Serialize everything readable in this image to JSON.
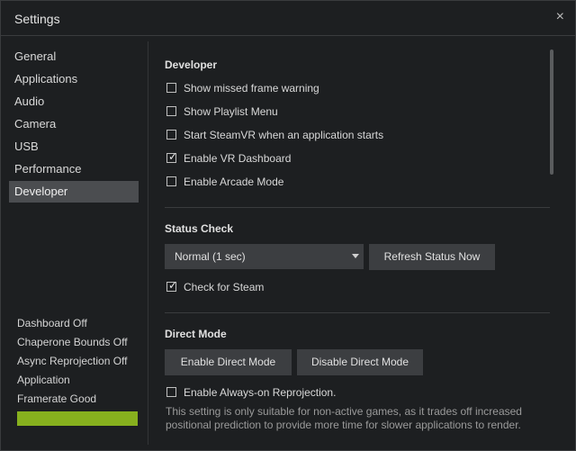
{
  "window": {
    "title": "Settings",
    "close_glyph": "×"
  },
  "sidebar": {
    "items": [
      {
        "label": "General"
      },
      {
        "label": "Applications"
      },
      {
        "label": "Audio"
      },
      {
        "label": "Camera"
      },
      {
        "label": "USB"
      },
      {
        "label": "Performance"
      },
      {
        "label": "Developer",
        "active": true
      }
    ],
    "status": {
      "dashboard": "Dashboard Off",
      "chaperone": "Chaperone Bounds Off",
      "async": "Async Reprojection Off",
      "application": "Application",
      "framerate": "Framerate Good",
      "framerate_color": "#87b01e"
    }
  },
  "developer": {
    "title": "Developer",
    "options": [
      {
        "label": "Show missed frame warning",
        "checked": false
      },
      {
        "label": "Show Playlist Menu",
        "checked": false
      },
      {
        "label": "Start SteamVR when an application starts",
        "checked": false
      },
      {
        "label": "Enable VR Dashboard",
        "checked": true
      },
      {
        "label": "Enable Arcade Mode",
        "checked": false
      }
    ]
  },
  "status_check": {
    "title": "Status Check",
    "select_value": "Normal (1 sec)",
    "refresh_label": "Refresh Status Now",
    "check_steam_label": "Check for Steam",
    "check_steam_checked": true
  },
  "direct_mode": {
    "title": "Direct Mode",
    "enable_label": "Enable Direct Mode",
    "disable_label": "Disable Direct Mode",
    "reprojection_label": "Enable Always-on Reprojection.",
    "reprojection_checked": false,
    "note": "This setting is only suitable for non-active games, as it trades off increased positional prediction to provide more time for slower applications to render."
  },
  "icons": {
    "close": "close-icon",
    "dropdown": "chevron-down-icon",
    "check": "checkmark-icon"
  }
}
